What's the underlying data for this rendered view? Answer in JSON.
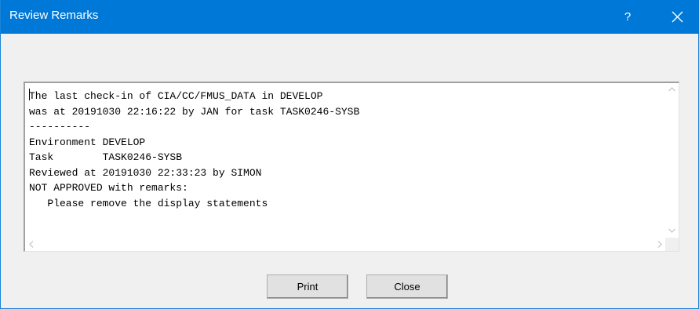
{
  "window": {
    "title": "Review Remarks",
    "help_label": "?"
  },
  "remarks": {
    "lines": [
      "The last check-in of CIA/CC/FMUS_DATA in DEVELOP",
      "was at 20191030 22:16:22 by JAN for task TASK0246-SYSB",
      "----------",
      "Environment DEVELOP",
      "Task        TASK0246-SYSB",
      "Reviewed at 20191030 22:33:23 by SIMON",
      "NOT APPROVED with remarks:",
      "   Please remove the display statements"
    ]
  },
  "buttons": {
    "print_label": "Print",
    "close_label": "Close"
  },
  "colors": {
    "titlebar": "#0078d7",
    "dialog_bg": "#f0f0f0",
    "button_bg": "#e1e1e1"
  },
  "icons": [
    "close-icon",
    "scroll-up-icon",
    "scroll-down-icon",
    "scroll-left-icon",
    "scroll-right-icon"
  ]
}
